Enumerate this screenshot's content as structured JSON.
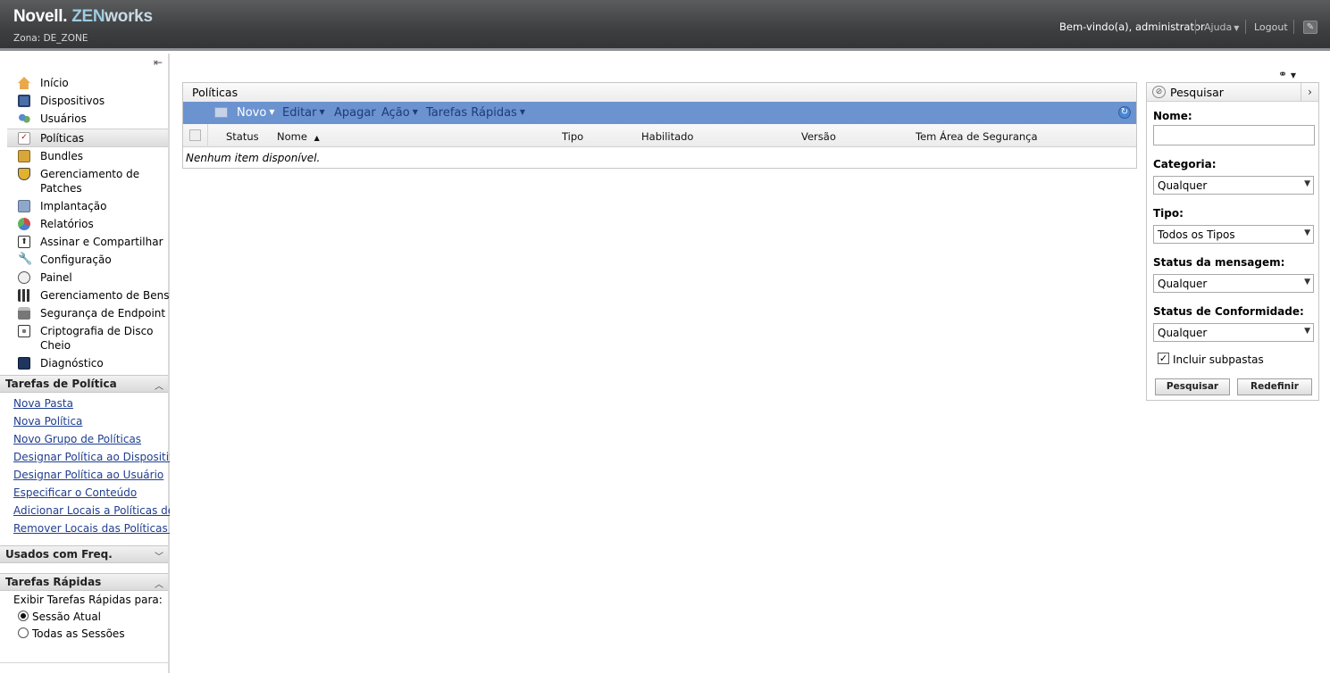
{
  "header": {
    "brand": "Novell.",
    "product_a": "ZEN",
    "product_b": "works",
    "zone": "Zona: DE_ZONE",
    "welcome": "Bem-vindo(a), administrator",
    "help": "Ajuda",
    "logout": "Logout"
  },
  "sidebar": {
    "items": [
      {
        "label": "Início",
        "icon": "home-icon"
      },
      {
        "label": "Dispositivos",
        "icon": "monitor-icon"
      },
      {
        "label": "Usuários",
        "icon": "users-icon"
      },
      {
        "label": "Políticas",
        "icon": "policy-icon"
      },
      {
        "label": "Bundles",
        "icon": "bundle-icon"
      },
      {
        "label": "Gerenciamento de",
        "label2": "Patches",
        "icon": "shield-icon"
      },
      {
        "label": "Implantação",
        "icon": "deploy-icon"
      },
      {
        "label": "Relatórios",
        "icon": "reports-icon"
      },
      {
        "label": "Assinar e Compartilhar",
        "icon": "share-icon"
      },
      {
        "label": "Configuração",
        "icon": "wrench-icon"
      },
      {
        "label": "Painel",
        "icon": "dashboard-icon"
      },
      {
        "label": "Gerenciamento de Bens",
        "icon": "asset-icon"
      },
      {
        "label": "Segurança de Endpoint",
        "icon": "lock-icon"
      },
      {
        "label": "Criptografia de Disco",
        "label2": "Cheio",
        "icon": "disk-icon"
      },
      {
        "label": "Diagnóstico",
        "icon": "diagnostic-icon"
      }
    ],
    "selected": "Políticas"
  },
  "policy_tasks": {
    "title": "Tarefas de Política",
    "links": [
      "Nova Pasta",
      "Nova Política",
      "Novo Grupo de Políticas",
      "Designar Política ao Dispositivo",
      "Designar Política ao Usuário",
      "Especificar o Conteúdo",
      "Adicionar Locais a Políticas de",
      "Remover Locais das Políticas de"
    ]
  },
  "frequent": {
    "title": "Usados com Freq."
  },
  "quick_tasks": {
    "title": "Tarefas Rápidas",
    "show_for": "Exibir Tarefas Rápidas para:",
    "option_current": "Sessão Atual",
    "option_all": "Todas as Sessões",
    "selected": "Sessão Atual"
  },
  "grid": {
    "title": "Políticas",
    "toolbar": {
      "new": "Novo",
      "edit": "Editar",
      "delete": "Apagar",
      "action": "Ação",
      "quick": "Tarefas Rápidas"
    },
    "columns": {
      "status": "Status",
      "name": "Nome",
      "type": "Tipo",
      "enabled": "Habilitado",
      "version": "Versão",
      "sandbox": "Tem Área de Segurança"
    },
    "sort_indicator": "▲",
    "empty": "Nenhum item disponível."
  },
  "search": {
    "title": "Pesquisar",
    "name_label": "Nome:",
    "name_value": "",
    "category_label": "Categoria:",
    "category_value": "Qualquer",
    "type_label": "Tipo:",
    "type_value": "Todos os Tipos",
    "msg_status_label": "Status da mensagem:",
    "msg_status_value": "Qualquer",
    "compliance_label": "Status de Conformidade:",
    "compliance_value": "Qualquer",
    "include_subfolders": "Incluir subpastas",
    "include_subfolders_checked": true,
    "search_button": "Pesquisar",
    "reset_button": "Redefinir"
  }
}
